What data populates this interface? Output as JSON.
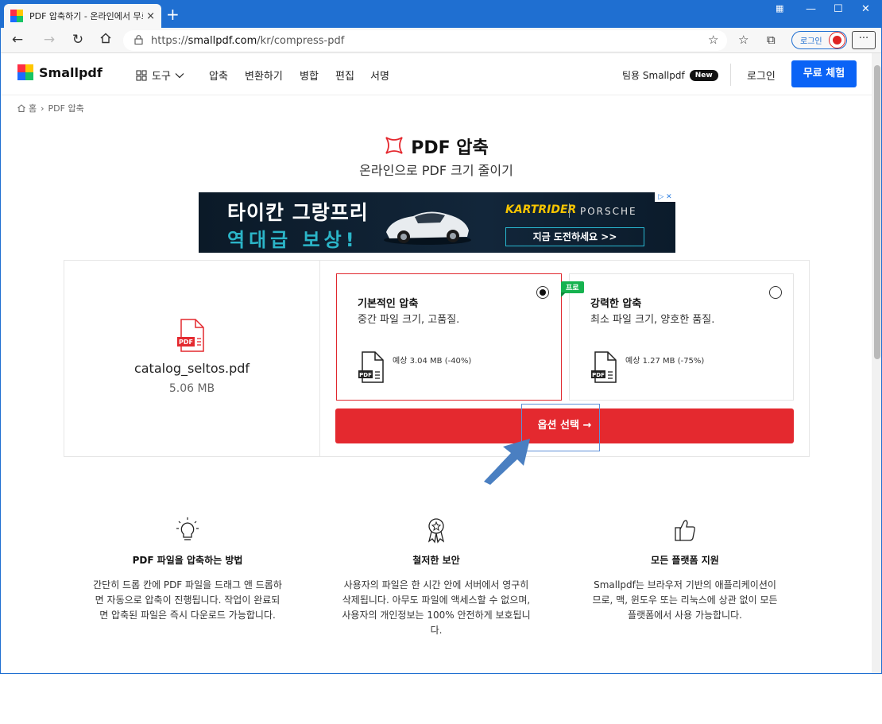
{
  "browser": {
    "tab_title": "PDF 압축하기 - 온라인에서 무료",
    "tab_close": "×",
    "new_tab": "+",
    "url_prefix": "https://",
    "url_host": "smallpdf.com",
    "url_path": "/kr/compress-pdf",
    "login_pill": "로그인",
    "more": "···"
  },
  "header": {
    "logo_text": "Smallpdf",
    "nav_tools": "도구",
    "nav_items": [
      "압축",
      "변환하기",
      "병합",
      "편집",
      "서명"
    ],
    "team_link": "팀용 Smallpdf",
    "new_badge": "New",
    "login": "로그인",
    "trial_button": "무료 체험"
  },
  "breadcrumb": {
    "home": "홈",
    "separator": "›",
    "current": "PDF 압축"
  },
  "hero": {
    "title": "PDF 압축",
    "subtitle": "온라인으로 PDF 크기 줄이기"
  },
  "ad": {
    "line1": "타이칸 그랑프리",
    "line2": "역대급 보상!",
    "brand1": "KARTRIDER",
    "brand2": "PORSCHE",
    "cta": "지금 도전하세요 >>",
    "badge": "▷ ✕"
  },
  "file": {
    "badge": "PDF",
    "name": "catalog_seltos.pdf",
    "size": "5.06 MB"
  },
  "options": [
    {
      "title": "기본적인 압축",
      "desc": "중간 파일 크기, 고품질.",
      "estimate": "예상 3.04 MB (-40%)",
      "selected": true
    },
    {
      "title": "강력한 압축",
      "desc": "최소 파일 크기, 양호한 품질.",
      "estimate": "예상 1.27 MB (-75%)",
      "selected": false
    }
  ],
  "pro_badge": "프로",
  "choose_button": "옵션 선택 →",
  "features": [
    {
      "icon": "lightbulb-icon",
      "title": "PDF 파일을 압축하는 방법",
      "text": "간단히 드롭 칸에 PDF 파일을 드래그 앤 드롭하면 자동으로 압축이 진행됩니다. 작업이 완료되면 압축된 파일은 즉시 다운로드 가능합니다."
    },
    {
      "icon": "award-icon",
      "title": "철저한 보안",
      "text": "사용자의 파일은 한 시간 안에 서버에서 영구히 삭제됩니다. 아무도 파일에 액세스할 수 없으며, 사용자의 개인정보는 100% 안전하게 보호됩니다."
    },
    {
      "icon": "thumbs-up-icon",
      "title": "모든 플랫폼 지원",
      "text": "Smallpdf는 브라우저 기반의 애플리케이션이므로, 맥, 윈도우 또는 리눅스에 상관 없이 모든 플랫폼에서 사용 가능합니다."
    }
  ],
  "colors": {
    "accent_red": "#e4292f",
    "brand_blue": "#0a63f6",
    "browser_blue": "#1f6fd1",
    "pro_green": "#16b24f"
  }
}
